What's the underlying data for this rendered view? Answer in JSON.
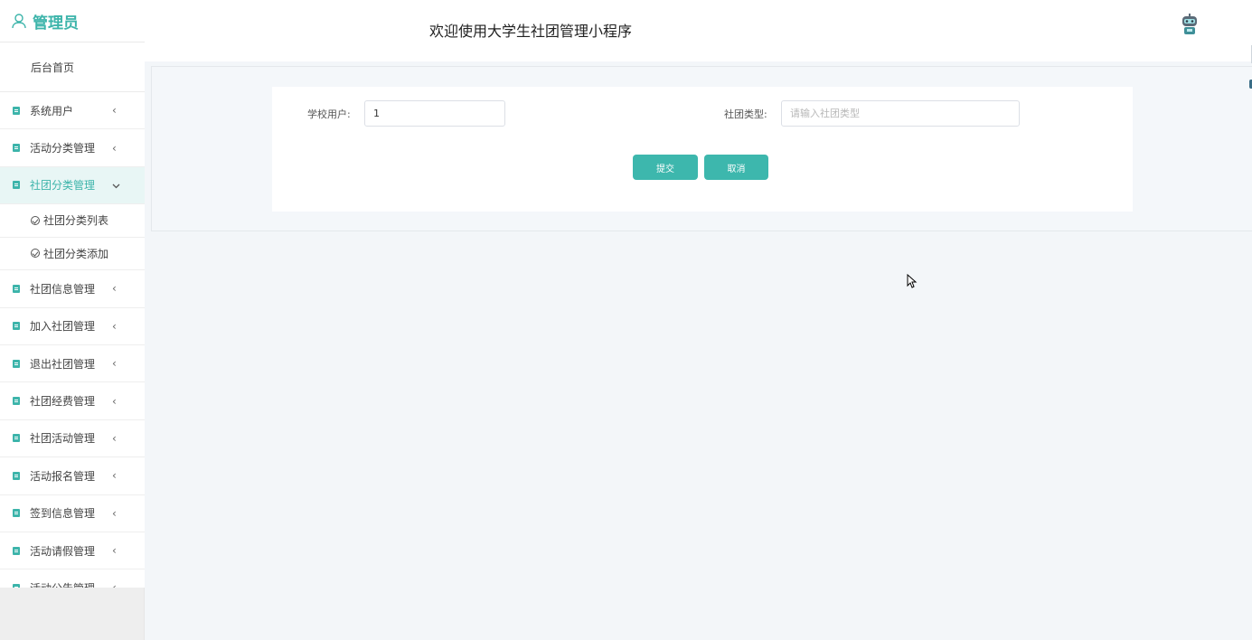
{
  "brand": {
    "title": "管理员",
    "icon": "user-icon"
  },
  "header": {
    "title": "欢迎使用大学生社团管理小程序",
    "avatar_icon": "robot-avatar-icon"
  },
  "sidebar": {
    "home": "后台首页",
    "items": [
      {
        "label": "系统用户"
      },
      {
        "label": "活动分类管理"
      },
      {
        "label": "社团分类管理",
        "active": true
      },
      {
        "label": "社团信息管理"
      },
      {
        "label": "加入社团管理"
      },
      {
        "label": "退出社团管理"
      },
      {
        "label": "社团经费管理"
      },
      {
        "label": "社团活动管理"
      },
      {
        "label": "活动报名管理"
      },
      {
        "label": "签到信息管理"
      },
      {
        "label": "活动请假管理"
      },
      {
        "label": "活动公告管理"
      }
    ],
    "subitems": [
      {
        "label": "社团分类列表"
      },
      {
        "label": "社团分类添加"
      }
    ]
  },
  "form": {
    "school_user_label": "学校用户:",
    "school_user_value": "1",
    "club_type_label": "社团类型:",
    "club_type_placeholder": "请输入社团类型",
    "submit_label": "提交",
    "cancel_label": "取消"
  },
  "colors": {
    "accent": "#3db7ad",
    "active_bg": "#e8f6f5"
  }
}
